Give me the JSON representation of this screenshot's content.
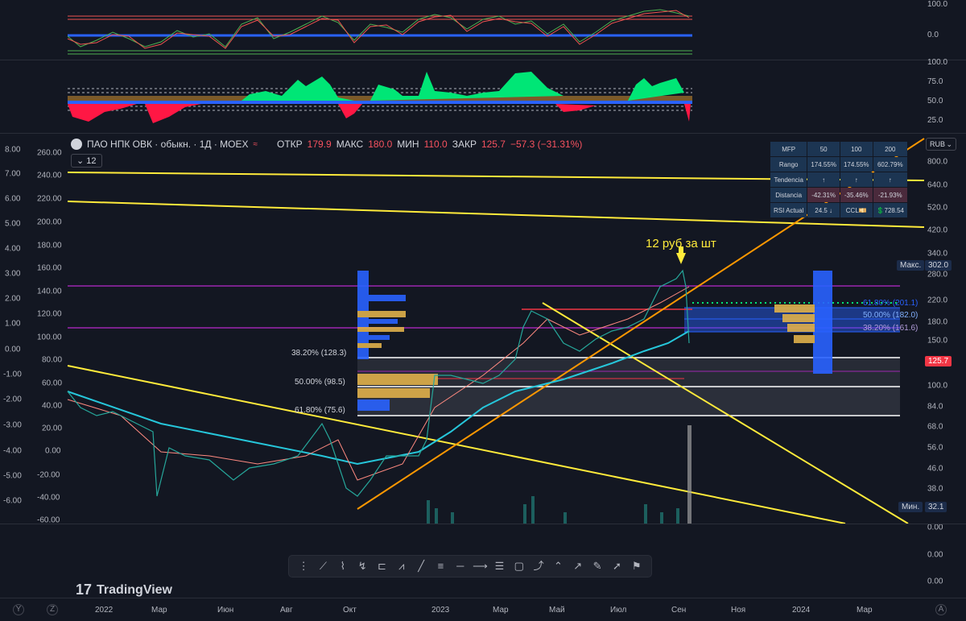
{
  "header": {
    "symbol": "ПАО НПК ОВК · обыкн. · 1Д · MOEX",
    "open_label": "ОТКР",
    "open_value": "179.9",
    "high_label": "МАКС",
    "high_value": "180.0",
    "low_label": "МИН",
    "low_value": "110.0",
    "close_label": "ЗАКР",
    "close_value": "125.7",
    "change": "−57.3 (−31.31%)",
    "indicator_count": "12",
    "currency": "RUB"
  },
  "annotation": "12 руб за шт",
  "price_badges": {
    "max_label": "Макс.",
    "max_value": "302.0",
    "current": "125.7",
    "min_label": "Мин.",
    "min_value": "32.1"
  },
  "fib": {
    "l382": "38.20% (128.3)",
    "l500": "50.00% (98.5)",
    "l618": "61.80% (75.6)",
    "r618": "61.80% (201.1)",
    "r500": "50.00% (182.0)",
    "r382": "38.20% (161.6)"
  },
  "mfp_table": {
    "headers": [
      "MFP",
      "50",
      "100",
      "200"
    ],
    "rows": [
      [
        "Rango",
        "174.55%",
        "174.55%",
        "602.79%"
      ],
      [
        "Tendencia",
        "↑",
        "↑",
        "↑"
      ],
      [
        "Distancia",
        "-42.31%",
        "-35.46%",
        "-21.93%"
      ],
      [
        "RSI Actual",
        "24.5 ↓",
        "CCL💴",
        "💲728.54"
      ]
    ]
  },
  "osc1_scale": [
    "100.0",
    "0.0"
  ],
  "osc2_scale": [
    "100.0",
    "75.0",
    "50.0",
    "25.0"
  ],
  "right_scale": [
    "800.0",
    "640.0",
    "520.0",
    "420.0",
    "340.0",
    "280.0",
    "220.0",
    "180.0",
    "150.0",
    "100.0",
    "84.0",
    "68.0",
    "56.0",
    "46.0",
    "38.0",
    "0.00",
    "0.00",
    "0.00"
  ],
  "left_scale_a": [
    "8.00",
    "7.00",
    "6.00",
    "5.00",
    "4.00",
    "3.00",
    "2.00",
    "1.00",
    "0.00",
    "-1.00",
    "-2.00",
    "-3.00",
    "-4.00",
    "-5.00",
    "-6.00"
  ],
  "left_scale_b": [
    "260.00",
    "240.00",
    "220.00",
    "200.00",
    "180.00",
    "160.00",
    "140.00",
    "120.00",
    "100.00",
    "80.00",
    "60.00",
    "40.00",
    "20.00",
    "0.00",
    "-20.00",
    "-40.00",
    "-60.00"
  ],
  "x_axis": [
    "2022",
    "Мар",
    "Июн",
    "Авг",
    "Окт",
    "2023",
    "Мар",
    "Май",
    "Июл",
    "Сен",
    "Ноя",
    "2024",
    "Мар"
  ],
  "corner_labels": {
    "left": "Y",
    "left2": "Z",
    "right": "A"
  },
  "brand": "TradingView",
  "colors": {
    "bg": "#131722",
    "up": "#26a69a",
    "down": "#ef5350",
    "yellow": "#ffeb3b",
    "orange": "#ff9800",
    "purple": "#9c27b0",
    "cyan": "#26c6da"
  }
}
